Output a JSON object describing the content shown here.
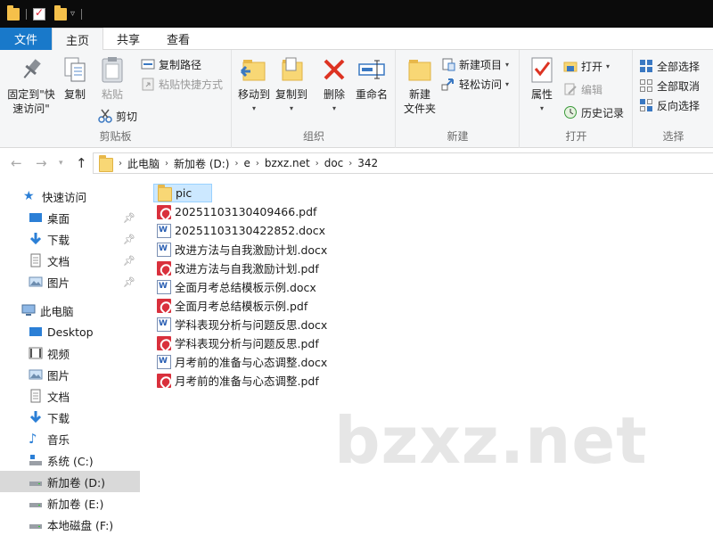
{
  "titlebar": {
    "quick_access": [
      "folder-icon",
      "properties-icon",
      "new-folder-icon"
    ]
  },
  "tabs": [
    {
      "label": "文件"
    },
    {
      "label": "主页"
    },
    {
      "label": "共享"
    },
    {
      "label": "查看"
    }
  ],
  "ribbon": {
    "clipboard": {
      "label": "剪贴板",
      "pin": "固定到\"快\n速访问\"",
      "copy": "复制",
      "paste": "粘贴",
      "copy_path": "复制路径",
      "paste_shortcut": "粘贴快捷方式",
      "cut": "剪切"
    },
    "organize": {
      "label": "组织",
      "move_to": "移动到",
      "copy_to": "复制到",
      "delete": "删除",
      "rename": "重命名"
    },
    "new": {
      "label": "新建",
      "new_folder": "新建\n文件夹",
      "new_item": "新建项目",
      "easy_access": "轻松访问"
    },
    "open": {
      "label": "打开",
      "properties": "属性",
      "open": "打开",
      "edit": "编辑",
      "history": "历史记录"
    },
    "select": {
      "label": "选择",
      "select_all": "全部选择",
      "select_none": "全部取消",
      "invert": "反向选择"
    }
  },
  "address": {
    "crumbs": [
      "此电脑",
      "新加卷 (D:)",
      "e",
      "bzxz.net",
      "doc",
      "342"
    ]
  },
  "navpane": {
    "quick_access": "快速访问",
    "quick_items": [
      "桌面",
      "下载",
      "文档",
      "图片"
    ],
    "this_pc": "此电脑",
    "pc_items": [
      "Desktop",
      "视频",
      "图片",
      "文档",
      "下载",
      "音乐",
      "系统 (C:)",
      "新加卷 (D:)",
      "新加卷 (E:)",
      "本地磁盘 (F:)"
    ]
  },
  "files": [
    {
      "name": "pic",
      "type": "folder"
    },
    {
      "name": "20251103130409466.pdf",
      "type": "pdf"
    },
    {
      "name": "20251103130422852.docx",
      "type": "docx"
    },
    {
      "name": "改进方法与自我激励计划.docx",
      "type": "docx"
    },
    {
      "name": "改进方法与自我激励计划.pdf",
      "type": "pdf"
    },
    {
      "name": "全面月考总结模板示例.docx",
      "type": "docx"
    },
    {
      "name": "全面月考总结模板示例.pdf",
      "type": "pdf"
    },
    {
      "name": "学科表现分析与问题反思.docx",
      "type": "docx"
    },
    {
      "name": "学科表现分析与问题反思.pdf",
      "type": "pdf"
    },
    {
      "name": "月考前的准备与心态调整.docx",
      "type": "docx"
    },
    {
      "name": "月考前的准备与心态调整.pdf",
      "type": "pdf"
    }
  ],
  "watermark": "bzxz.net",
  "colors": {
    "file_tab": "#1979ca",
    "selection": "#cce8ff",
    "folder": "#f8d775",
    "pdf": "#d9303c"
  }
}
